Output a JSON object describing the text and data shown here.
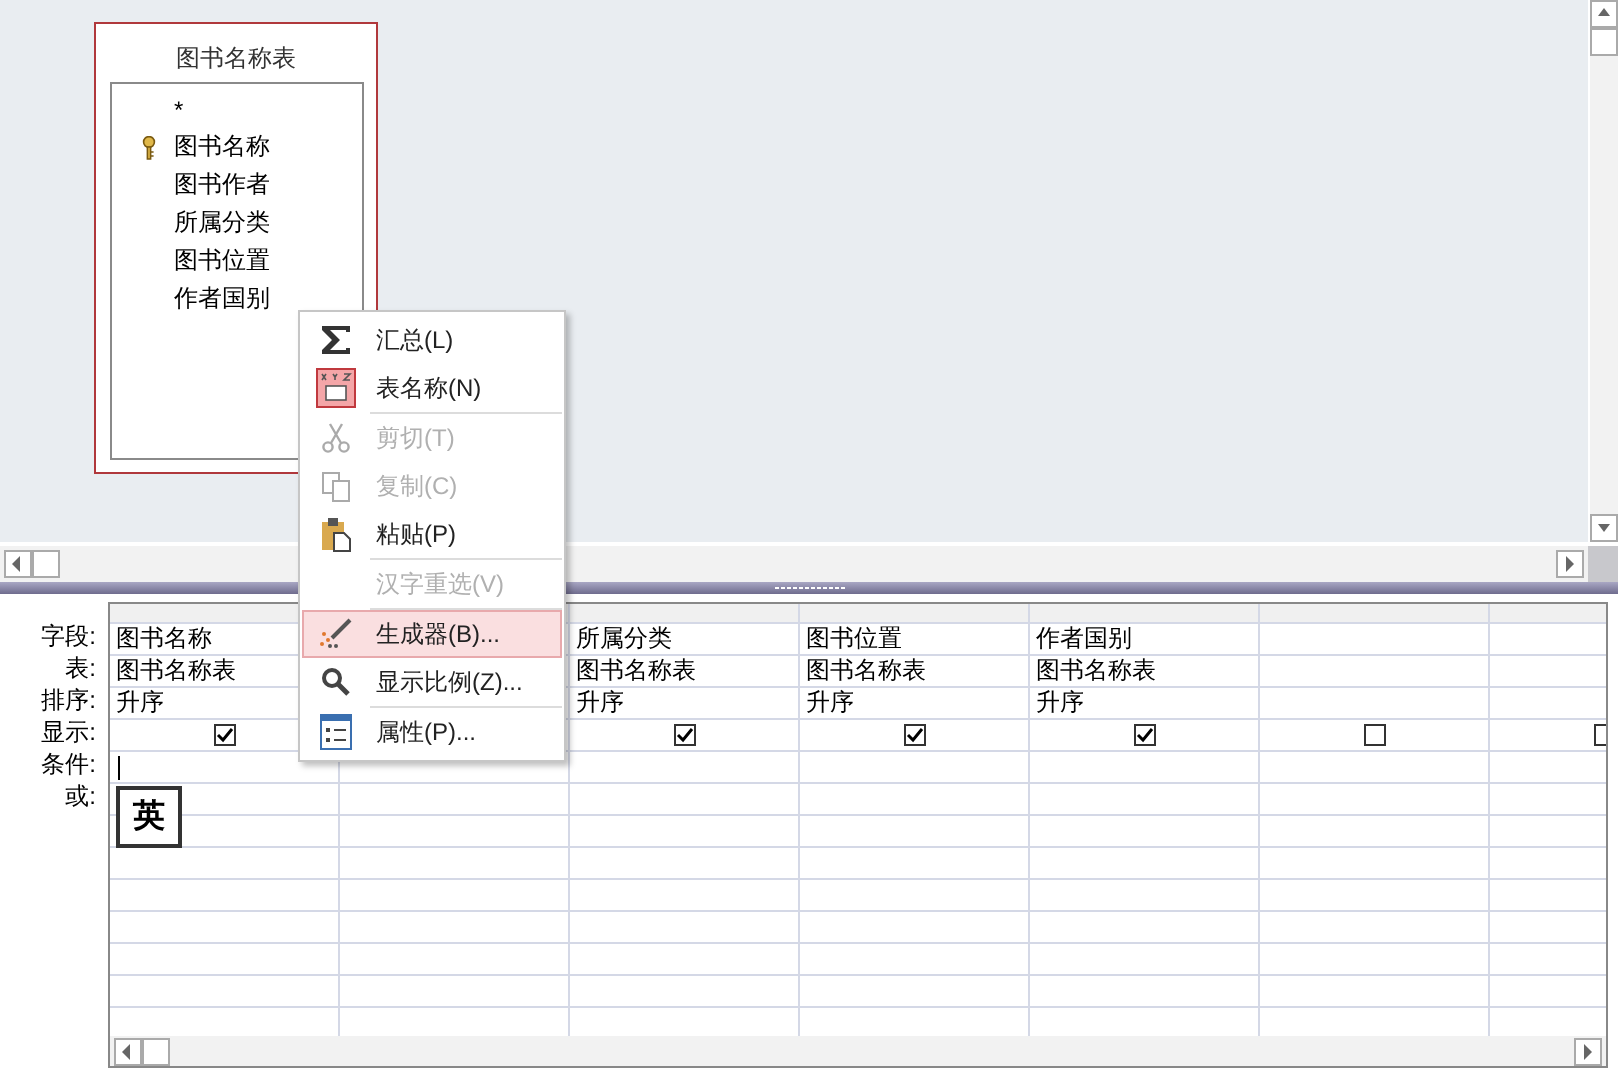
{
  "table_box": {
    "title": "图书名称表",
    "fields": [
      {
        "name": "*",
        "primary_key": false
      },
      {
        "name": "图书名称",
        "primary_key": true
      },
      {
        "name": "图书作者",
        "primary_key": false
      },
      {
        "name": "所属分类",
        "primary_key": false
      },
      {
        "name": "图书位置",
        "primary_key": false
      },
      {
        "name": "作者国别",
        "primary_key": false
      }
    ]
  },
  "grid": {
    "row_labels": [
      "字段:",
      "表:",
      "排序:",
      "显示:",
      "条件:",
      "或:"
    ],
    "columns": [
      {
        "field": "图书名称",
        "table": "图书名称表",
        "sort": "升序",
        "show": true,
        "criteria_focused": true
      },
      {},
      {
        "field": "所属分类",
        "table": "图书名称表",
        "sort": "升序",
        "show": true
      },
      {
        "field": "图书位置",
        "table": "图书名称表",
        "sort": "升序",
        "show": true
      },
      {
        "field": "作者国别",
        "table": "图书名称表",
        "sort": "升序",
        "show": true
      },
      {
        "show": false
      },
      {
        "show": false
      }
    ]
  },
  "ime_indicator": {
    "label": "英"
  },
  "context_menu": [
    {
      "kind": "item",
      "label": "汇总(L)",
      "disabled": false,
      "selected": false
    },
    {
      "kind": "item",
      "label": "表名称(N)",
      "disabled": false,
      "selected": false
    },
    {
      "kind": "separator"
    },
    {
      "kind": "item",
      "label": "剪切(T)",
      "disabled": true,
      "selected": false
    },
    {
      "kind": "item",
      "label": "复制(C)",
      "disabled": true,
      "selected": false
    },
    {
      "kind": "item",
      "label": "粘贴(P)",
      "disabled": false,
      "selected": false
    },
    {
      "kind": "separator"
    },
    {
      "kind": "item",
      "label": "汉字重选(V)",
      "disabled": true,
      "selected": false
    },
    {
      "kind": "separator"
    },
    {
      "kind": "item",
      "label": "生成器(B)...",
      "disabled": false,
      "selected": true
    },
    {
      "kind": "item",
      "label": "显示比例(Z)...",
      "disabled": false,
      "selected": false
    },
    {
      "kind": "separator"
    },
    {
      "kind": "item",
      "label": "属性(P)...",
      "disabled": false,
      "selected": false
    }
  ]
}
